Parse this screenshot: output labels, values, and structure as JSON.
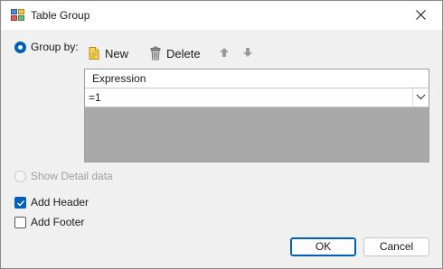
{
  "window": {
    "title": "Table Group",
    "icon": "table-group-app-icon"
  },
  "group_by": {
    "label": "Group by:",
    "selected": true
  },
  "toolbar": {
    "new_label": "New",
    "new_icon": "new-document-icon",
    "delete_label": "Delete",
    "delete_icon": "trash-icon",
    "move_up_icon": "arrow-up-icon",
    "move_down_icon": "arrow-down-icon"
  },
  "grid": {
    "columns": [
      "Expression"
    ],
    "rows": [
      {
        "expression": "=1"
      }
    ]
  },
  "show_detail": {
    "label": "Show Detail data",
    "selected": false,
    "enabled": false
  },
  "add_header": {
    "label": "Add Header",
    "checked": true
  },
  "add_footer": {
    "label": "Add Footer",
    "checked": false
  },
  "buttons": {
    "ok_label": "OK",
    "cancel_label": "Cancel"
  },
  "colors": {
    "accent": "#005fb8",
    "grid_background": "#a9a9a9",
    "dialog_background": "#f0f0f0"
  }
}
